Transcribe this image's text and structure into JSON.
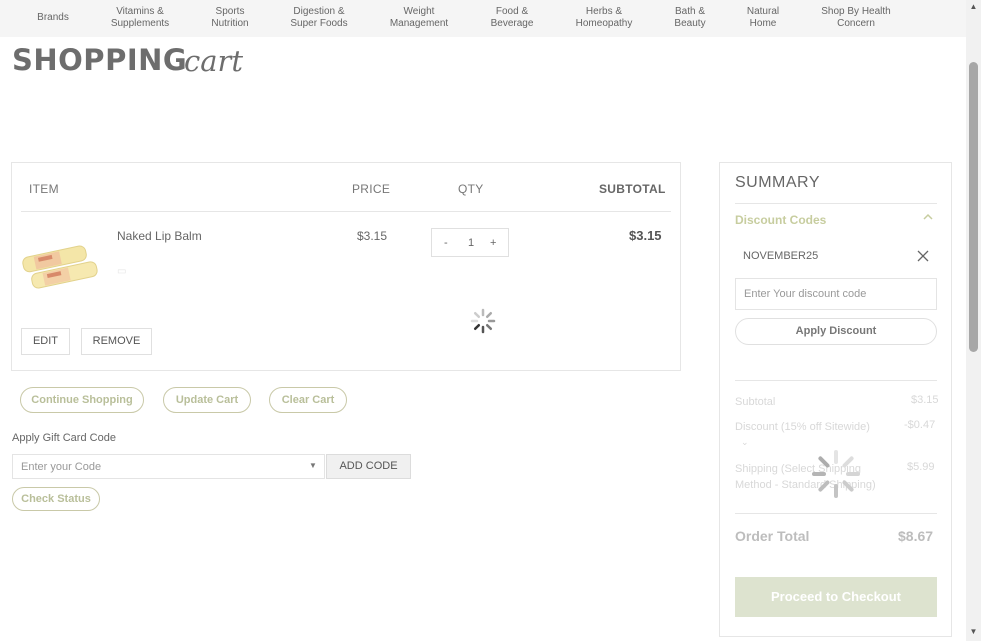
{
  "nav": {
    "items": [
      "Brands",
      "Vitamins &\nSupplements",
      "Sports\nNutrition",
      "Digestion &\nSuper Foods",
      "Weight\nManagement",
      "Food &\nBeverage",
      "Herbs &\nHomeopathy",
      "Bath &\nBeauty",
      "Natural\nHome",
      "Shop By Health\nConcern"
    ]
  },
  "page": {
    "title_main": "SHOPPING",
    "title_script": "cart"
  },
  "cart": {
    "headers": {
      "item": "ITEM",
      "price": "PRICE",
      "qty": "QTY",
      "subtotal": "SUBTOTAL"
    },
    "item": {
      "name": "Naked Lip Balm",
      "price": "$3.15",
      "qty": "1",
      "qty_minus": "-",
      "qty_plus": "+",
      "subtotal": "$3.15"
    },
    "edit_label": "EDIT",
    "remove_label": "REMOVE"
  },
  "actions": {
    "continue_shopping": "Continue Shopping",
    "update_cart": "Update Cart",
    "clear_cart": "Clear Cart"
  },
  "gift_card": {
    "label": "Apply Gift Card Code",
    "placeholder": "Enter your Code",
    "add_code": "ADD CODE",
    "check_status": "Check Status"
  },
  "summary": {
    "title": "SUMMARY",
    "discount_codes_label": "Discount Codes",
    "applied_code": "NOVEMBER25",
    "discount_placeholder": "Enter Your discount code",
    "apply_discount": "Apply Discount",
    "subtotal_label": "Subtotal",
    "subtotal_value": "$3.15",
    "discount_label": "Discount (15% off Sitewide)",
    "discount_value": "-$0.47",
    "shipping_label": "Shipping (Select Shipping Method - Standard Shipping)",
    "shipping_value": "$5.99",
    "order_total_label": "Order Total",
    "order_total_value": "$8.67",
    "checkout": "Proceed to Checkout"
  },
  "colors": {
    "accent_olive": "#c7cd9f",
    "checkout_bg": "#dde3cf",
    "nav_bg": "#f5f5f5"
  }
}
